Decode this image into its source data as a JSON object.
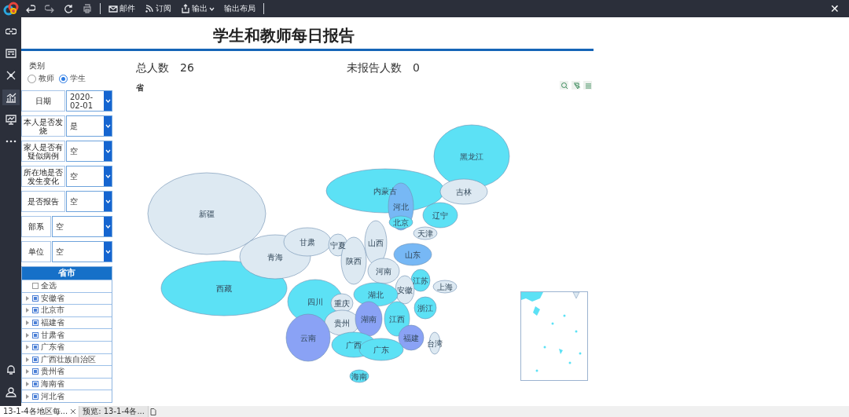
{
  "toolbar": {
    "items": [
      {
        "kind": "icon"
      },
      {
        "kind": "icon"
      },
      {
        "kind": "icon"
      },
      {
        "kind": "icon"
      },
      {
        "kind": "sep"
      },
      {
        "kind": "text",
        "label": "邮件"
      },
      {
        "kind": "text",
        "label": "订阅"
      },
      {
        "kind": "menu",
        "label": "输出"
      },
      {
        "kind": "text",
        "label": "输出布局"
      },
      {
        "kind": "sep"
      }
    ],
    "close": "✕"
  },
  "sidebar": {
    "items": [
      {
        "selected": false
      },
      {
        "selected": false
      },
      {
        "selected": false
      },
      {
        "selected": true
      },
      {
        "selected": false
      },
      {
        "selected": false
      }
    ]
  },
  "report": {
    "title": "学生和教师每日报告"
  },
  "filters": {
    "category": {
      "label": "类别",
      "options": [
        {
          "label": "教师",
          "selected": false
        },
        {
          "label": "学生",
          "selected": true
        }
      ]
    },
    "fields": [
      {
        "label": "日期",
        "value": "2020-02-01",
        "wide": false
      },
      {
        "label": "本人是否发烧",
        "value": "是",
        "wide": false
      },
      {
        "label": "家人是否有疑似病例",
        "value": "空",
        "wide": false
      },
      {
        "label": "所在地是否发生变化",
        "value": "空",
        "wide": false
      },
      {
        "label": "是否报告",
        "value": "空",
        "wide": false
      },
      {
        "label": "部系",
        "value": "空",
        "wide": true
      },
      {
        "label": "单位",
        "value": "空",
        "wide": true
      }
    ],
    "tree": {
      "title": "省市",
      "items": [
        {
          "label": "全选",
          "checked": false,
          "expandable": false
        },
        {
          "label": "安徽省",
          "checked": true,
          "expandable": true
        },
        {
          "label": "北京市",
          "checked": true,
          "expandable": true
        },
        {
          "label": "福建省",
          "checked": true,
          "expandable": true
        },
        {
          "label": "甘肃省",
          "checked": true,
          "expandable": true
        },
        {
          "label": "广东省",
          "checked": true,
          "expandable": true
        },
        {
          "label": "广西壮族自治区",
          "checked": true,
          "expandable": true
        },
        {
          "label": "贵州省",
          "checked": true,
          "expandable": true
        },
        {
          "label": "海南省",
          "checked": true,
          "expandable": true
        },
        {
          "label": "河北省",
          "checked": true,
          "expandable": true
        }
      ]
    }
  },
  "stats": [
    {
      "label": "总人数",
      "value": "26"
    },
    {
      "label": "未报告人数",
      "value": "0"
    }
  ],
  "map": {
    "title": "省",
    "provinces": [
      {
        "name": "新疆",
        "color": "#dde9f2"
      },
      {
        "name": "西藏",
        "color": "#5ce1f5"
      },
      {
        "name": "青海",
        "color": "#dde9f2"
      },
      {
        "name": "甘肃",
        "color": "#dde9f2"
      },
      {
        "name": "内蒙古",
        "color": "#5ce1f5"
      },
      {
        "name": "黑龙江",
        "color": "#5ce1f5"
      },
      {
        "name": "吉林",
        "color": "#dde9f2"
      },
      {
        "name": "河北",
        "color": "#77b8f5"
      },
      {
        "name": "北京",
        "color": "#5ce1f5"
      },
      {
        "name": "天津",
        "color": "#dde9f2"
      },
      {
        "name": "辽宁",
        "color": "#5ce1f5"
      },
      {
        "name": "宁夏",
        "color": "#dde9f2"
      },
      {
        "name": "山西",
        "color": "#dde9f2"
      },
      {
        "name": "陕西",
        "color": "#dde9f2"
      },
      {
        "name": "山东",
        "color": "#77b8f5"
      },
      {
        "name": "河南",
        "color": "#dde9f2"
      },
      {
        "name": "江苏",
        "color": "#5ce1f5"
      },
      {
        "name": "安徽",
        "color": "#dde9f2"
      },
      {
        "name": "上海",
        "color": "#dde9f2"
      },
      {
        "name": "四川",
        "color": "#5ce1f5"
      },
      {
        "name": "重庆",
        "color": "#dde9f2"
      },
      {
        "name": "湖北",
        "color": "#5ce1f5"
      },
      {
        "name": "浙江",
        "color": "#5ce1f5"
      },
      {
        "name": "贵州",
        "color": "#dde9f2"
      },
      {
        "name": "湖南",
        "color": "#8aa2f5"
      },
      {
        "name": "江西",
        "color": "#5ce1f5"
      },
      {
        "name": "福建",
        "color": "#8aa2f5"
      },
      {
        "name": "云南",
        "color": "#8aa2f5"
      },
      {
        "name": "广西",
        "color": "#5ce1f5"
      },
      {
        "name": "广东",
        "color": "#5ce1f5"
      },
      {
        "name": "台湾",
        "color": "#dde9f2"
      },
      {
        "name": "海南",
        "color": "#5ce1f5"
      }
    ]
  },
  "tabs": [
    {
      "label": "13-1-4各地区每...",
      "selected": true,
      "closable": true
    },
    {
      "label": "预览: 13-1-4各...",
      "selected": false,
      "closable": false
    }
  ]
}
